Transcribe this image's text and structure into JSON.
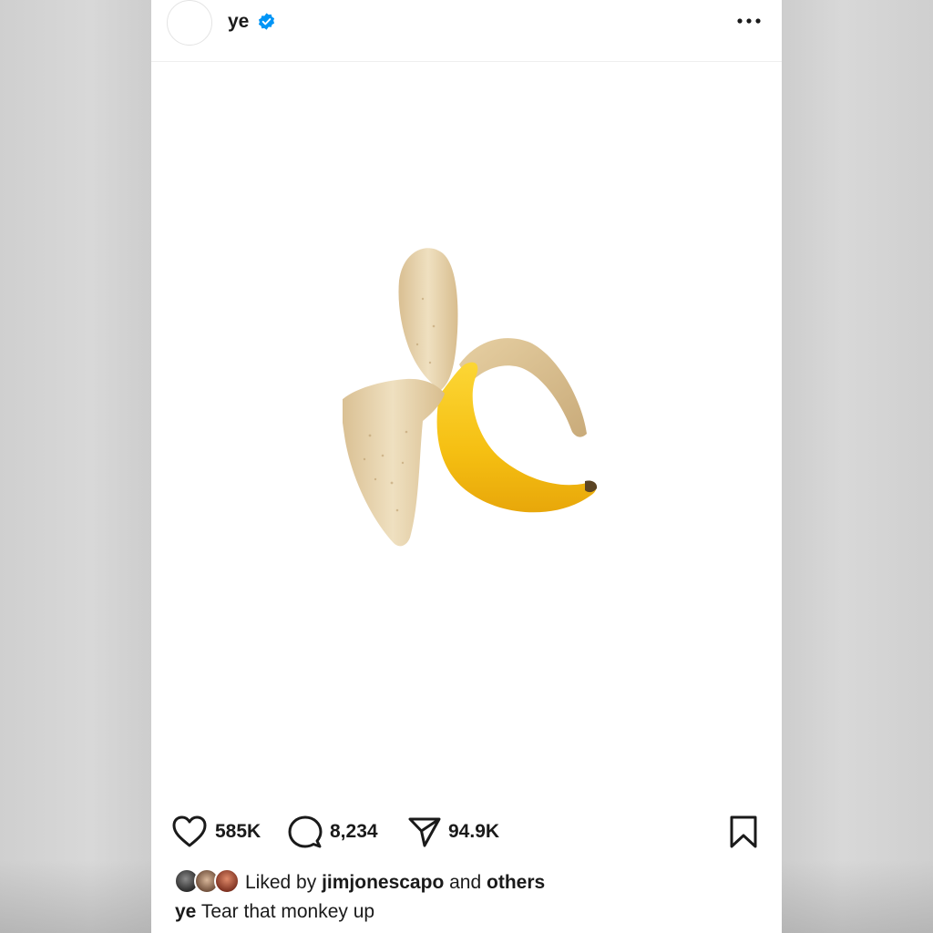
{
  "header": {
    "username": "ye",
    "verified": true,
    "avatar_icon": "profile-avatar",
    "more_icon": "more-dots-icon"
  },
  "media": {
    "subject_icon": "peeled-banana-image"
  },
  "actions": {
    "like_count": "585K",
    "comment_count": "8,234",
    "share_count": "94.9K",
    "like_icon": "heart-icon",
    "comment_icon": "comment-bubble-icon",
    "share_icon": "paper-plane-icon",
    "save_icon": "bookmark-icon"
  },
  "likes": {
    "prefix": "Liked by",
    "user": "jimjonescapo",
    "connector": "and",
    "others": "others"
  },
  "caption": {
    "username": "ye",
    "text": "Tear that monkey up"
  },
  "colors": {
    "verified_blue": "#0095f6",
    "banana_yellow": "#f6c116",
    "peel_cream": "#e8d2a8",
    "background_gray": "#d4d4d4"
  }
}
